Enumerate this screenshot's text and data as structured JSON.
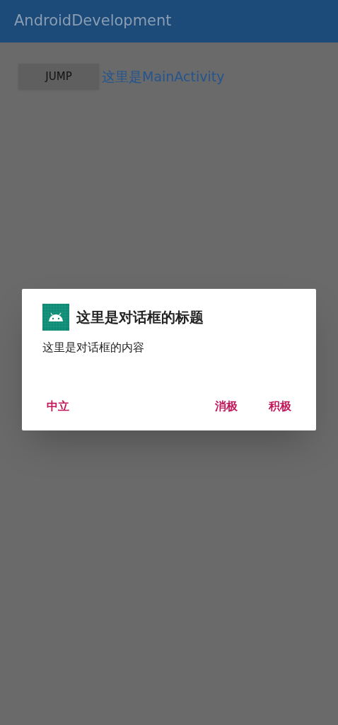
{
  "app_bar": {
    "title": "AndroidDevelopment"
  },
  "content": {
    "button": "JUMP",
    "text": "这里是MainActivity"
  },
  "dialog": {
    "title": "这里是对话框的标题",
    "message": "这里是对话框的内容",
    "buttons": [
      {
        "label": "中立",
        "kind": "neutral"
      },
      {
        "label": "消极",
        "kind": "negative"
      },
      {
        "label": "积极",
        "kind": "positive"
      }
    ]
  }
}
